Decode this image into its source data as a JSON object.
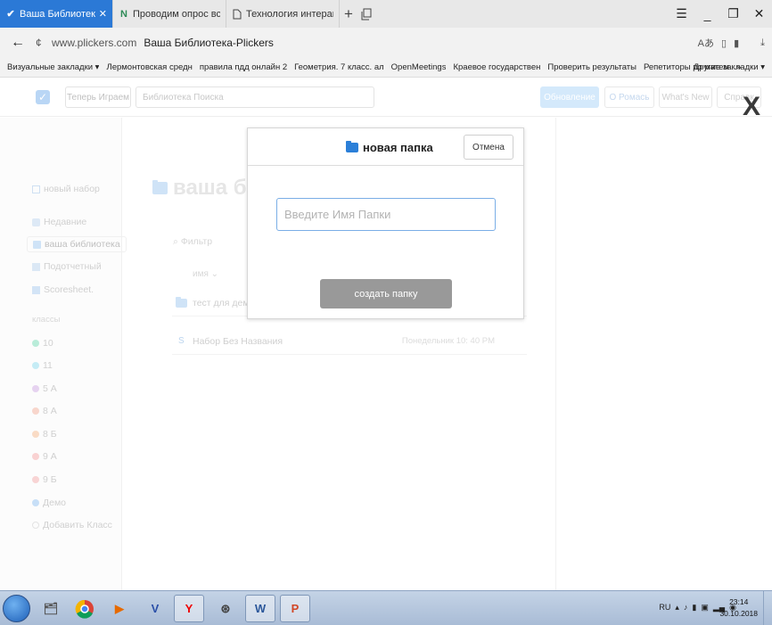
{
  "browser": {
    "tabs": [
      {
        "title": "Ваша Библиотека-Plicker",
        "close": "✕"
      },
      {
        "title": "Проводим опрос всего кла"
      },
      {
        "title": "Технология интерактивно"
      }
    ],
    "url_host": "www.plickers.com",
    "url_title": "Ваша Библиотека-Plickers",
    "bookmarks": [
      "Визуальные закладки ▾",
      "Лермонтовская средн",
      "правила пдд онлайн 2",
      "Геометрия. 7 класс. ал",
      "OpenMeetings",
      "Краевое государствен",
      "Проверить результаты",
      "Репетиторы по матем",
      "»"
    ],
    "other_bookmarks": "Другие закладки ▾"
  },
  "header": {
    "play_label": "Теперь Играем",
    "search_placeholder": "Библиотека Поиска",
    "update_label": "Обновление",
    "about_label": "О Ромась",
    "whats_new_label": "What's New",
    "help_label": "Справк",
    "close_glyph": "X"
  },
  "sidebar": {
    "new_set": "новый набор",
    "nav": [
      "Недавние",
      "ваша библиотека",
      "Подотчетный",
      "Scoresheet."
    ],
    "classes_title": "классы",
    "classes": [
      {
        "name": "10",
        "color": "#b9ecd9"
      },
      {
        "name": "11",
        "color": "#c5ecf5"
      },
      {
        "name": "5 А",
        "color": "#e6d3f0"
      },
      {
        "name": "8 А",
        "color": "#f8d6cc"
      },
      {
        "name": "8 Б",
        "color": "#f9dbc5"
      },
      {
        "name": "9 А",
        "color": "#f9d2d2"
      },
      {
        "name": "9 Б",
        "color": "#f8d4d4"
      },
      {
        "name": "Демо",
        "color": "#c7dff7"
      }
    ],
    "add_class": "Добавить Класс"
  },
  "main": {
    "title": "ваша би",
    "filter_placeholder": "Фильтр",
    "column_name": "имя",
    "rows": [
      {
        "title": "тест для демо",
        "date": ""
      },
      {
        "title": "Набор Без Названия",
        "date": "Понедельник 10: 40 PM"
      }
    ]
  },
  "modal": {
    "title": "новая папка",
    "cancel_label": "Отмена",
    "input_placeholder": "Введите Имя Папки",
    "create_label": "создать папку"
  },
  "taskbar": {
    "lang": "RU",
    "time": "23:14",
    "date": "30.10.2018"
  }
}
